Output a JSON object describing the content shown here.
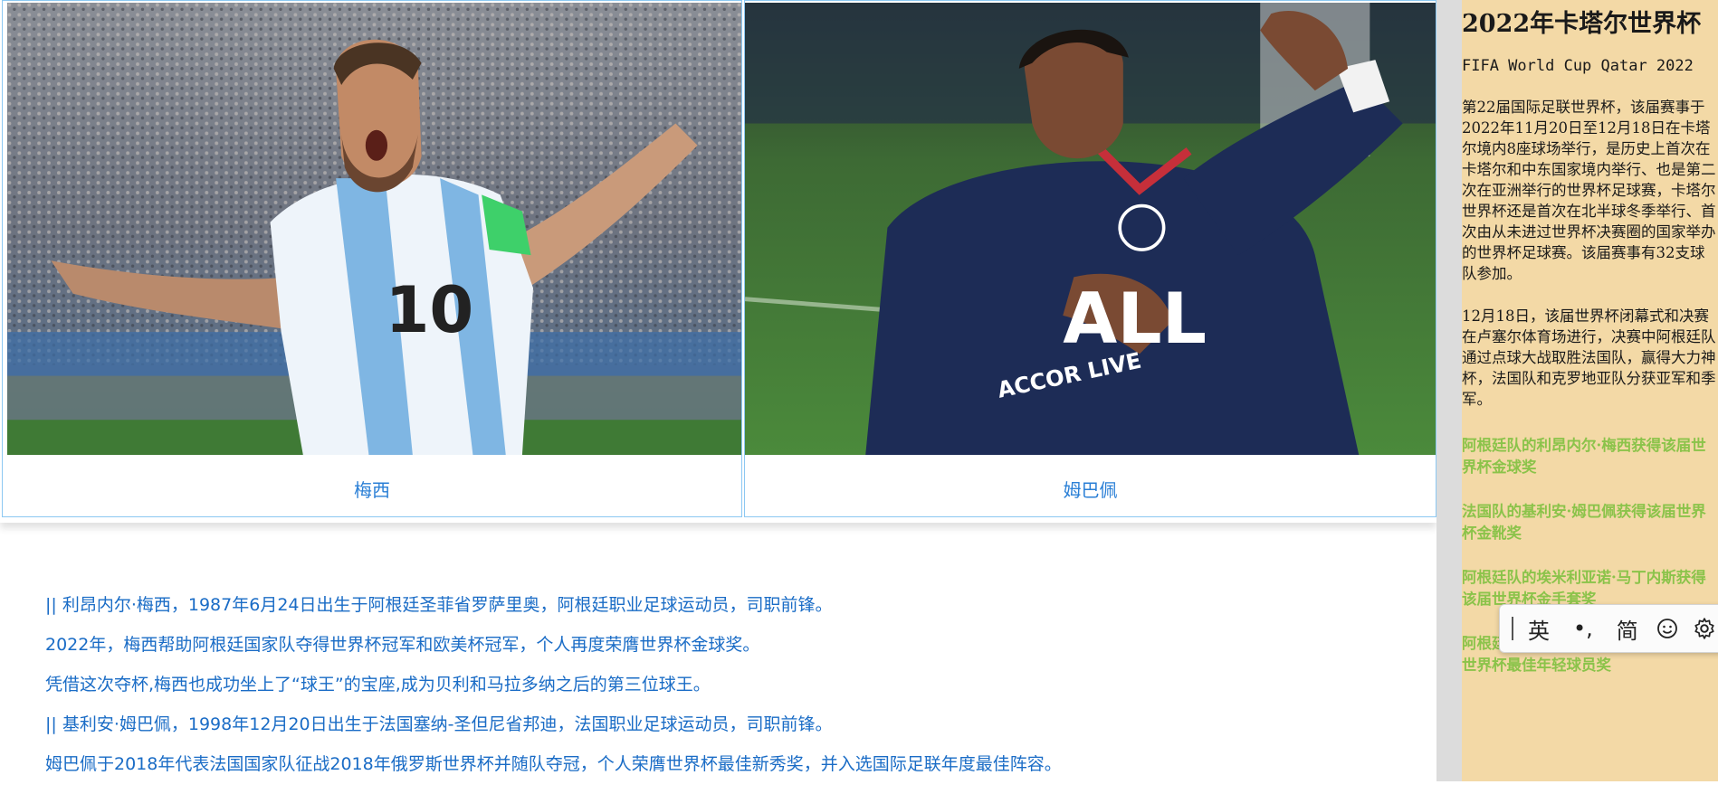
{
  "cards": [
    {
      "caption": "梅西",
      "image": "messi-photo"
    },
    {
      "caption": "姆巴佩",
      "image": "mbappe-photo"
    }
  ],
  "messi_photo": {
    "jersey_number": "10"
  },
  "mbappe_photo": {
    "sponsor": "ALL",
    "sponsor_sub": "ACCOR LIVE"
  },
  "article": [
    "|| 利昂内尔·梅西，1987年6月24日出生于阿根廷圣菲省罗萨里奥，阿根廷职业足球运动员，司职前锋。",
    "2022年，梅西帮助阿根廷国家队夺得世界杯冠军和欧美杯冠军，个人再度荣膺世界杯金球奖。",
    "凭借这次夺杯,梅西也成功坐上了“球王”的宝座,成为贝利和马拉多纳之后的第三位球王。",
    "|| 基利安·姆巴佩，1998年12月20日出生于法国塞纳-圣但尼省邦迪，法国职业足球运动员，司职前锋。",
    "姆巴佩于2018年代表法国国家队征战2018年俄罗斯世界杯并随队夺冠，个人荣膺世界杯最佳新秀奖，并入选国际足联年度最佳阵容。"
  ],
  "panel": {
    "title": "2022年卡塔尔世界杯",
    "subtitle": "FIFA World Cup Qatar 2022",
    "para1": "第22届国际足联世界杯，该届赛事于2022年11月20日至12月18日在卡塔尔境内8座球场举行，是历史上首次在卡塔尔和中东国家境内举行、也是第二次在亚洲举行的世界杯足球赛，卡塔尔世界杯还是首次在北半球冬季举行、首次由从未进过世界杯决赛圈的国家举办的世界杯足球赛。该届赛事有32支球队参加。",
    "para2": "12月18日，该届世界杯闭幕式和决赛在卢塞尔体育场进行，决赛中阿根廷队通过点球大战取胜法国队，赢得大力神杯，法国队和克罗地亚队分获亚军和季军。",
    "awards": [
      "阿根廷队的利昂内尔·梅西获得该届世界杯金球奖",
      "法国队的基利安·姆巴佩获得该届世界杯金靴奖",
      "阿根廷队的埃米利亚诺·马丁内斯获得该届世界杯金手套奖",
      "阿根廷队的恩佐·费尔南德斯获得该届世界杯最佳年轻球员奖"
    ],
    "award_color": "#8bc34a",
    "background": "#f3d9a6"
  },
  "ime": {
    "lang": "英",
    "punct": "•,",
    "script": "简",
    "icons": [
      "drag-handle-icon",
      "emoji-icon",
      "gear-icon"
    ]
  },
  "colors": {
    "link_blue": "#1a6cc6",
    "card_border": "#8cc8f2"
  }
}
